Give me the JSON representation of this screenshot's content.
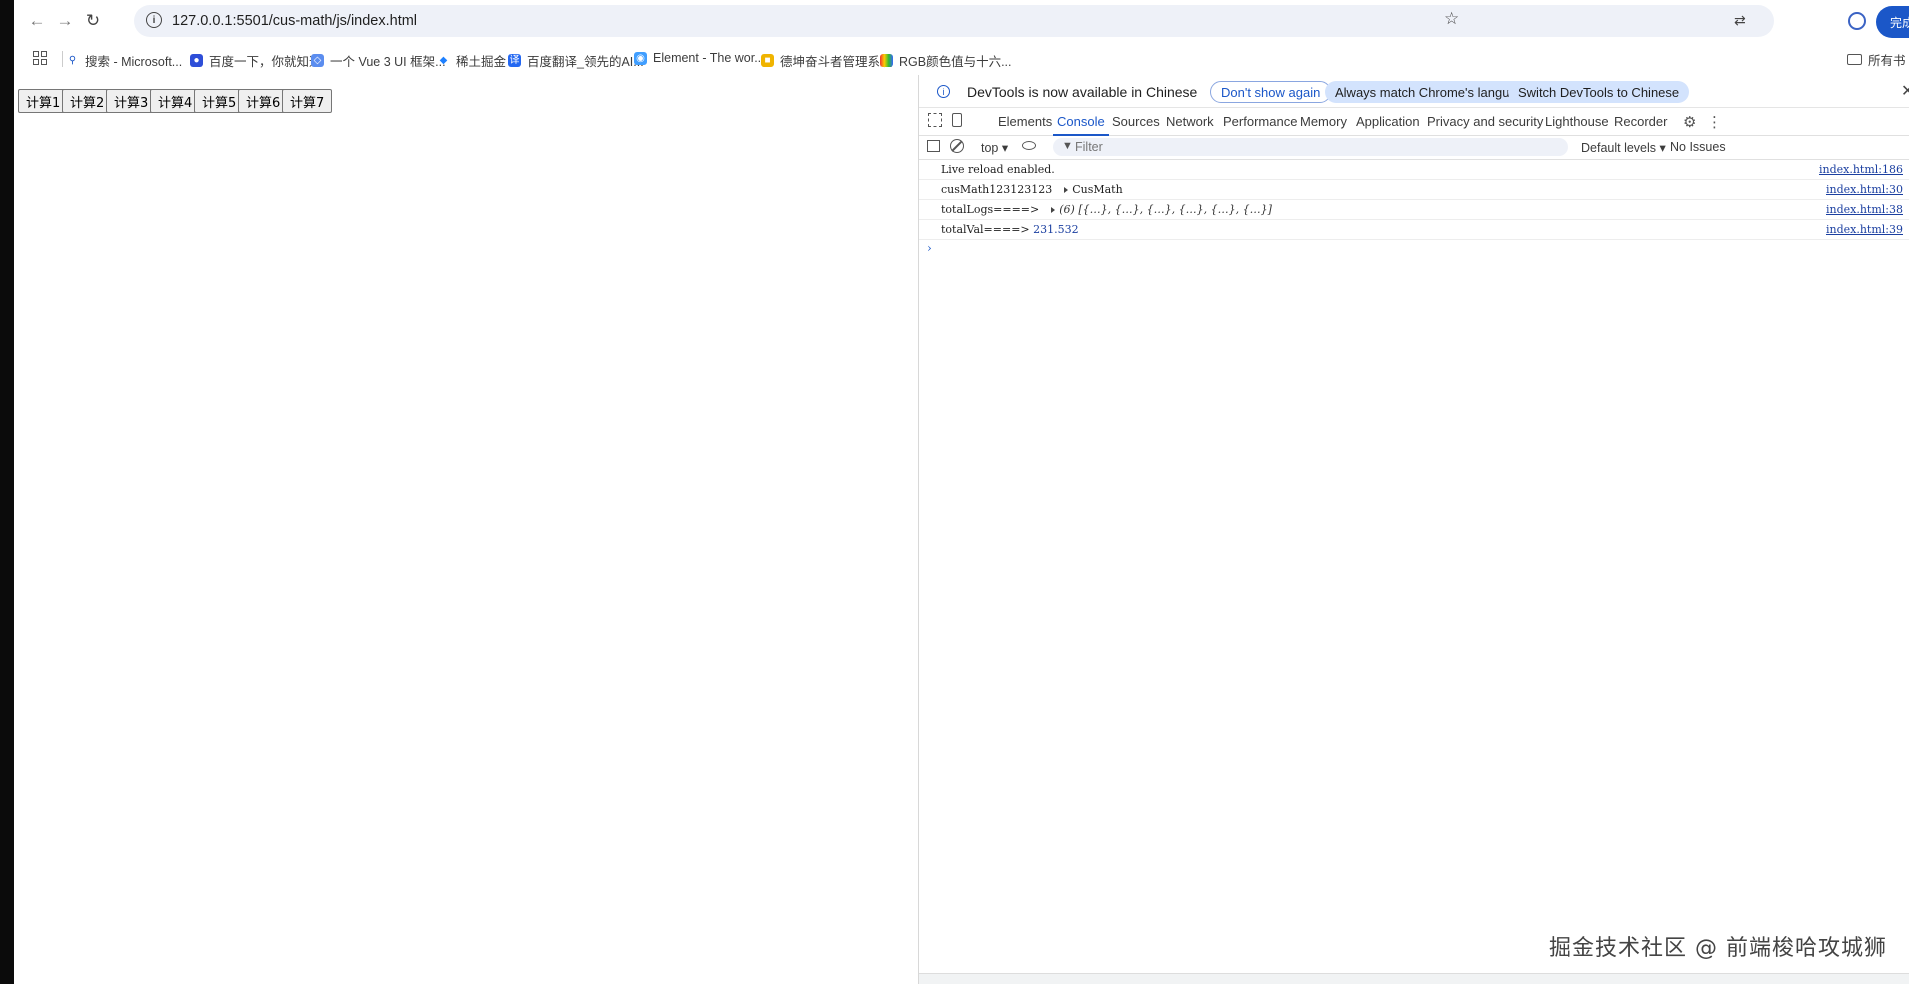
{
  "browser": {
    "url": "127.0.0.1:5501/cus-math/js/index.html",
    "update_label": "完成更新"
  },
  "bookmarks": {
    "items": [
      {
        "label": "搜索 - Microsoft...",
        "icon": "search-icon"
      },
      {
        "label": "百度一下，你就知道",
        "icon": "baidu-icon"
      },
      {
        "label": "一个 Vue 3 UI 框架...",
        "icon": "vue-icon"
      },
      {
        "label": "稀土掘金",
        "icon": "juejin-icon"
      },
      {
        "label": "百度翻译_领先的AI...",
        "icon": "translate-icon"
      },
      {
        "label": "Element - The wor...",
        "icon": "element-icon"
      },
      {
        "label": "德坤奋斗者管理系统",
        "icon": "folder-icon"
      },
      {
        "label": "RGB颜色值与十六...",
        "icon": "rainbow-icon"
      }
    ],
    "all_label": "所有书"
  },
  "page": {
    "buttons": [
      "计算1",
      "计算2",
      "计算3",
      "计算4",
      "计算5",
      "计算6",
      "计算7"
    ]
  },
  "devtools": {
    "banner": {
      "message": "DevTools is now available in Chinese",
      "dont_show": "Don't show again",
      "always_match": "Always match Chrome's language",
      "switch": "Switch DevTools to Chinese"
    },
    "tabs": [
      "Elements",
      "Console",
      "Sources",
      "Network",
      "Performance",
      "Memory",
      "Application",
      "Privacy and security",
      "Lighthouse",
      "Recorder"
    ],
    "active_tab": "Console",
    "console_bar": {
      "context": "top ▾",
      "filter_placeholder": "Filter",
      "levels": "Default levels ▾",
      "issues": "No Issues"
    },
    "logs": [
      {
        "text": "Live reload enabled.",
        "source": "index.html:186"
      },
      {
        "text": "cusMath123123123",
        "value": "CusMath",
        "source": "index.html:30"
      },
      {
        "text": "totalLogs====>",
        "value": "(6) [{…}, {…}, {…}, {…}, {…}, {…}]",
        "source": "index.html:38"
      },
      {
        "text": "totalVal====>",
        "value": "231.532",
        "source": "index.html:39"
      }
    ],
    "prompt": "›"
  },
  "watermark": "掘金技术社区 @ 前端梭哈攻城狮",
  "colors": {
    "accent": "#1b57c8",
    "url_bg": "#eef1f8",
    "pill_bg": "#d3e3fd"
  }
}
